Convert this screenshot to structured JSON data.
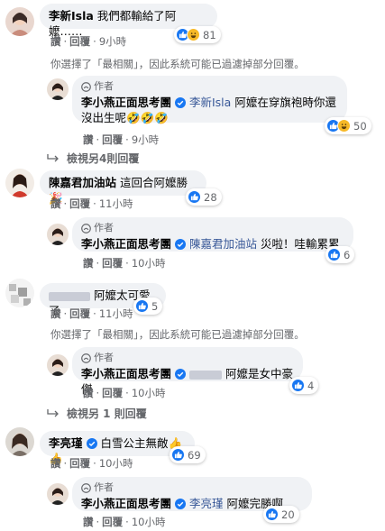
{
  "comments": [
    {
      "author": "李新Isla",
      "text": "我們都輸給了阿嬤……",
      "actions": {
        "like": "讚",
        "reply": "回覆",
        "time": "9小時"
      },
      "reactions": "81",
      "notice": "你選擇了「最相關」，因此系統可能已過濾掉部分回覆。",
      "reply": {
        "tag": "作者",
        "author": "李小燕正面思考團",
        "mention": "李新Isla",
        "text": "阿嬤在穿旗袍時你還沒出生呢🤣🤣🤣",
        "actions": {
          "like": "讚",
          "reply": "回覆",
          "time": "9小時"
        },
        "reactions": "50"
      }
    },
    {
      "more_replies": "檢視另4則回覆",
      "author": "陳嘉君加油站",
      "text": "這回合阿嬤勝🎉",
      "actions": {
        "like": "讚",
        "reply": "回覆",
        "time": "11小時"
      },
      "reactions": "28",
      "reply": {
        "tag": "作者",
        "author": "李小燕正面思考團",
        "mention": "陳嘉君加油站",
        "text": "災啦！哇輸累累",
        "actions": {
          "like": "讚",
          "reply": "回覆",
          "time": "10小時"
        },
        "reactions": "6"
      }
    },
    {
      "author": "",
      "text": "阿嬤太可愛了",
      "actions": {
        "like": "讚",
        "reply": "回覆",
        "time": "11小時"
      },
      "reactions": "5",
      "notice": "你選擇了「最相關」，因此系統可能已過濾掉部分回覆。",
      "reply": {
        "tag": "作者",
        "author": "李小燕正面思考團",
        "mention": "",
        "text": "阿嬤是女中豪傑",
        "actions": {
          "like": "讚",
          "reply": "回覆",
          "time": "10小時"
        },
        "reactions": "4"
      }
    },
    {
      "more_replies": "檢視另 1 則回覆",
      "author": "李亮瑾",
      "text": "白雪公主無敵👍👍",
      "actions": {
        "like": "讚",
        "reply": "回覆",
        "time": "10小時"
      },
      "reactions": "69",
      "reply": {
        "tag": "作者",
        "author": "李小燕正面思考團",
        "mention": "李亮瑾",
        "text": "阿嬤完勝啊",
        "actions": {
          "like": "讚",
          "reply": "回覆",
          "time": "10小時"
        },
        "reactions": "20"
      }
    }
  ],
  "colors": {
    "bubble": "#f0f2f5",
    "link": "#385898",
    "like": "#1877f2",
    "muted": "#65676b",
    "verified": "#1877f2"
  },
  "icons": [
    "like-icon",
    "haha-icon",
    "care-icon",
    "verified-icon",
    "author-icon",
    "reply-arrow-icon"
  ]
}
